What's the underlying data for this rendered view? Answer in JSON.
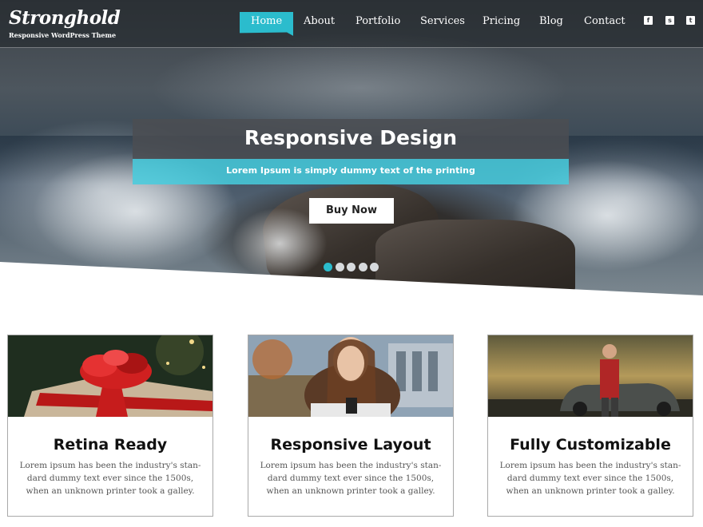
{
  "header": {
    "logo": "Stronghold",
    "tagline": "Responsive WordPress Theme",
    "nav": [
      {
        "label": "Home",
        "active": true
      },
      {
        "label": "About",
        "active": false
      },
      {
        "label": "Portfolio",
        "active": false
      },
      {
        "label": "Services",
        "active": false
      },
      {
        "label": "Pricing",
        "active": false
      },
      {
        "label": "Blog",
        "active": false
      },
      {
        "label": "Contact",
        "active": false
      }
    ],
    "social": [
      {
        "icon": "facebook-icon",
        "glyph": "f"
      },
      {
        "icon": "skype-icon",
        "glyph": "s"
      },
      {
        "icon": "twitter-icon",
        "glyph": "t"
      }
    ]
  },
  "slider": {
    "title": "Responsive Design",
    "subtitle": "Lorem Ipsum is simply dummy text of the printing",
    "button_label": "Buy Now",
    "slides_count": 5,
    "active_slide": 1
  },
  "features": [
    {
      "title": "Retina Ready",
      "text": "Lorem ipsum has been the industry's stan-dard dummy text ever since the 1500s, when an unknown printer took a galley.",
      "image": "red-gift-box-photo"
    },
    {
      "title": "Responsive Layout",
      "text": "Lorem ipsum has been the industry's stan-dard dummy text ever since the 1500s, when an unknown printer took a galley.",
      "image": "woman-with-phone-photo"
    },
    {
      "title": "Fully Customizable",
      "text": "Lorem ipsum has been the industry's stan-dard dummy text ever since the 1500s, when an unknown printer took a galley.",
      "image": "man-with-vintage-car-photo"
    }
  ],
  "colors": {
    "accent": "#2bbccd",
    "caption_dark": "#4b4e52",
    "text": "#111111"
  }
}
